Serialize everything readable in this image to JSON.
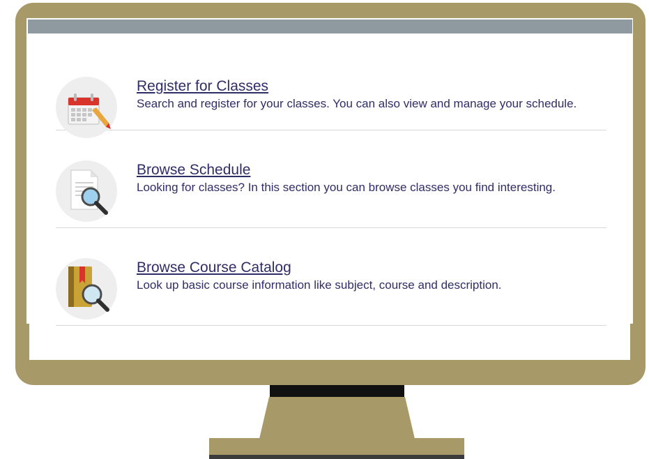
{
  "colors": {
    "frame": "#a89a68",
    "screen_top_bar": "#8e9aa0",
    "text": "#2f2d67",
    "icon_background": "#eeeeee"
  },
  "items": [
    {
      "title": "Register for Classes",
      "description": "Search and register for your classes. You can also view and manage your schedule.",
      "icon": "calendar-pencil-icon"
    },
    {
      "title": "Browse Schedule",
      "description": "Looking for classes? In this section you can browse classes you find interesting.",
      "icon": "document-magnifier-icon"
    },
    {
      "title": "Browse Course Catalog",
      "description": "Look up basic course information like subject, course and description.",
      "icon": "book-magnifier-icon"
    }
  ]
}
